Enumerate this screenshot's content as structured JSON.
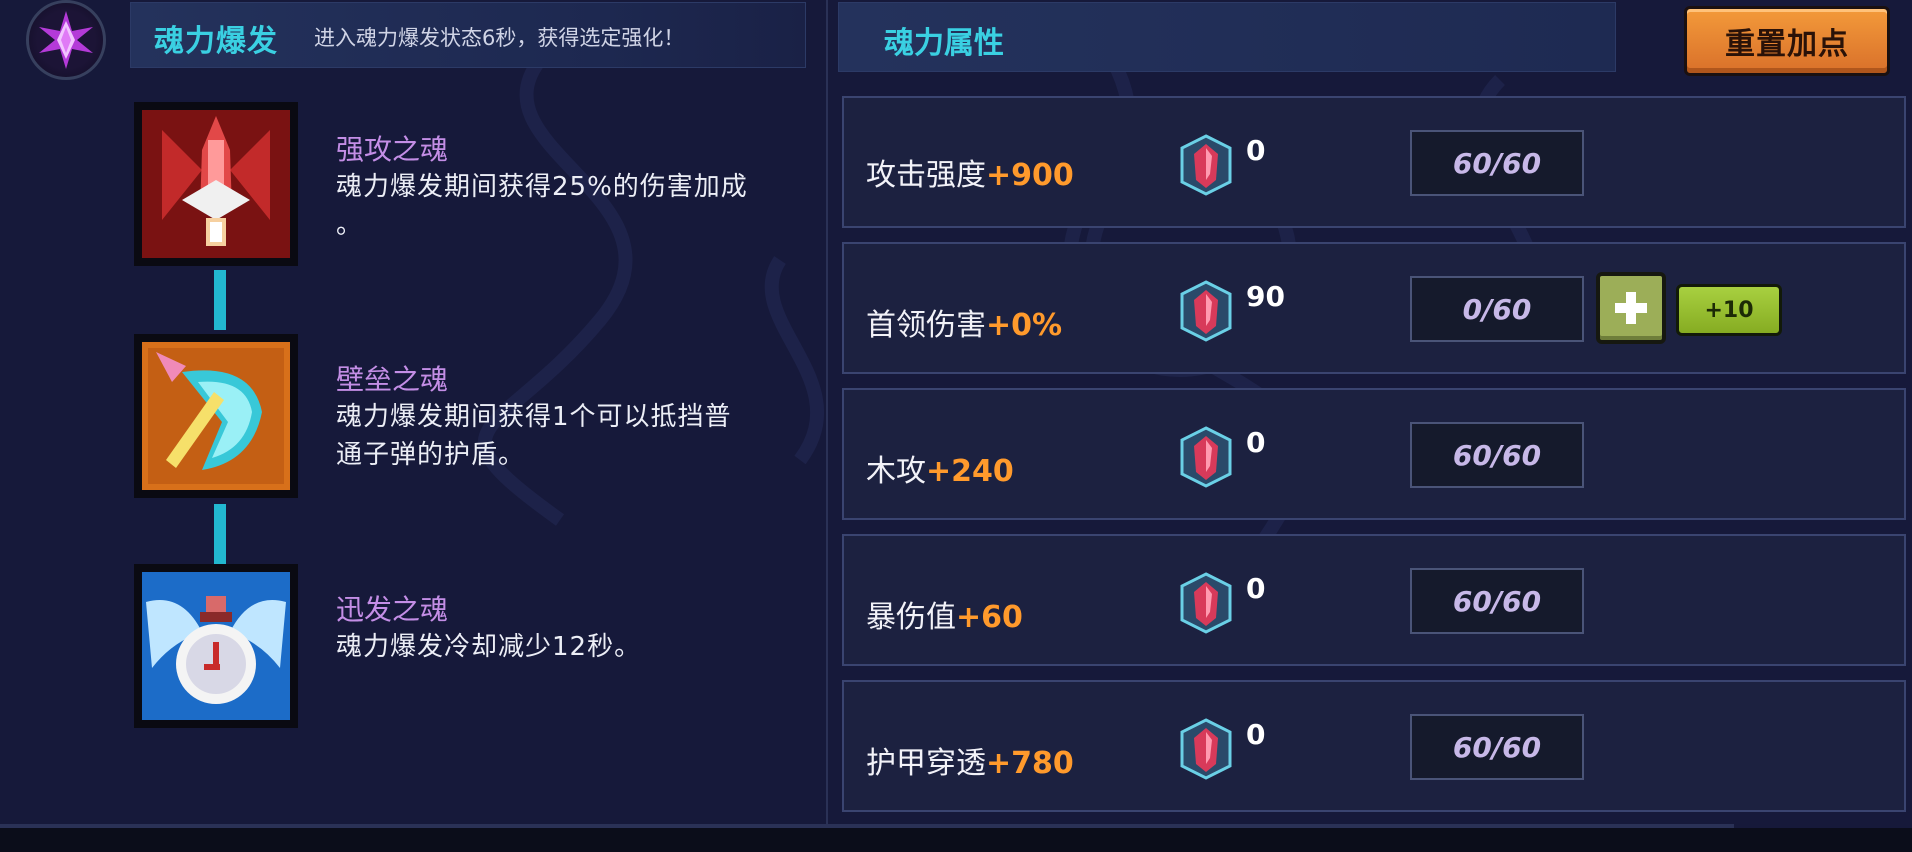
{
  "burst": {
    "title": "魂力爆发",
    "description": "进入魂力爆发状态6秒，获得选定强化！",
    "icon": "purple-crystal-star-icon"
  },
  "skills": [
    {
      "name": "强攻之魂",
      "desc_line1": "魂力爆发期间获得25%的伤害加成",
      "desc_line2": "。",
      "icon": "red-rocket-icon"
    },
    {
      "name": "壁垒之魂",
      "desc_line1": "魂力爆发期间获得1个可以抵挡普",
      "desc_line2": "通子弹的护盾。",
      "icon": "orange-shield-icon"
    },
    {
      "name": "迅发之魂",
      "desc_line1": "魂力爆发冷却减少12秒。",
      "desc_line2": "",
      "icon": "blue-winged-clock-icon"
    }
  ],
  "attributes_panel": {
    "title": "魂力属性",
    "reset_label": "重置加点"
  },
  "attributes": [
    {
      "label": "攻击强度",
      "bonus": "+900",
      "cost": "0",
      "level": "60/60"
    },
    {
      "label": "首领伤害",
      "bonus": "+0%",
      "cost": "90",
      "level": "0/60",
      "plus_label": "+10"
    },
    {
      "label": "木攻",
      "bonus": "+240",
      "cost": "0",
      "level": "60/60"
    },
    {
      "label": "暴伤值",
      "bonus": "+60",
      "cost": "0",
      "level": "60/60"
    },
    {
      "label": "护甲穿透",
      "bonus": "+780",
      "cost": "0",
      "level": "60/60"
    }
  ],
  "colors": {
    "accent_cyan": "#3ad0e2",
    "bonus_orange": "#ff9a2c",
    "skill_name_purple": "#c48ee6",
    "reset_orange": "#e8842f",
    "plus_green": "#9cae58"
  }
}
